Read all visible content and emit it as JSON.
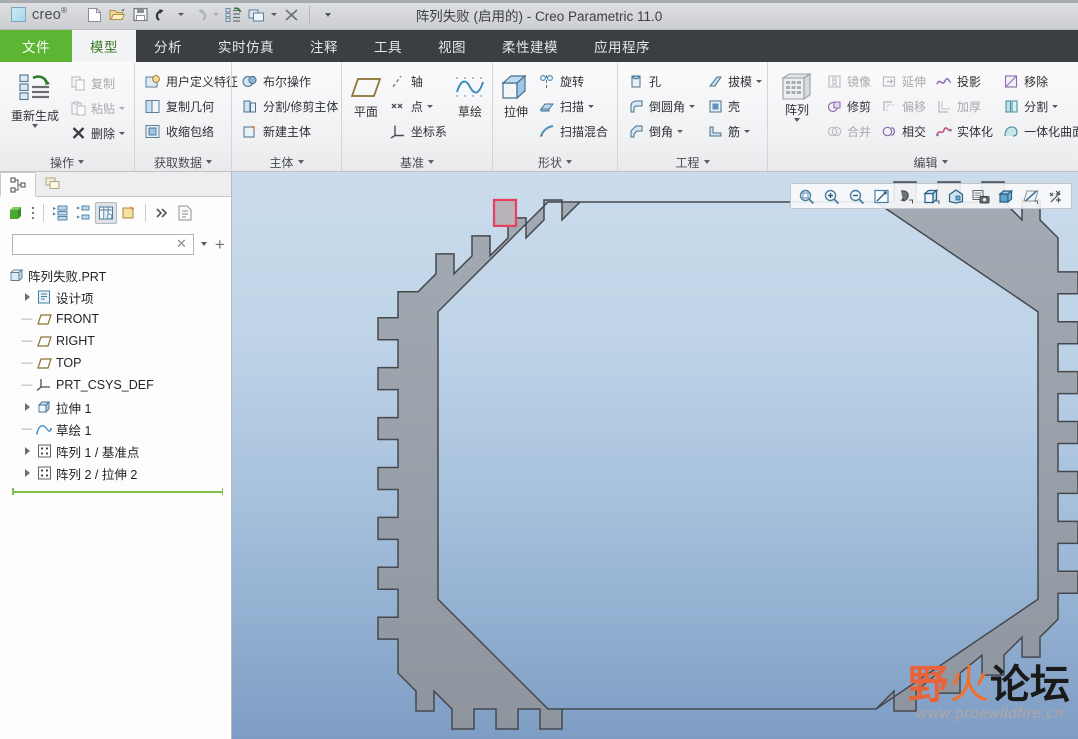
{
  "titlebar": {
    "brand": "creo",
    "brand_sup": "®",
    "document_title": "阵列失败 (启用的) - Creo Parametric 11.0",
    "quick_access": [
      {
        "name": "new-file-button",
        "icon": "new-file-icon",
        "label": "新建"
      },
      {
        "name": "open-file-button",
        "icon": "open-folder-icon",
        "label": "打开"
      },
      {
        "name": "save-button",
        "icon": "save-disk-icon",
        "label": "保存"
      },
      {
        "name": "undo-button",
        "icon": "undo-arrow-icon",
        "label": "撤消"
      },
      {
        "name": "redo-button",
        "icon": "redo-arrow-icon",
        "label": "重做"
      },
      {
        "name": "regenerate-button",
        "icon": "regenerate-icon",
        "label": "重新生成"
      },
      {
        "name": "window-button",
        "icon": "windows-icon",
        "label": "窗口"
      },
      {
        "name": "close-window-button",
        "icon": "close-x-icon",
        "label": "关闭"
      },
      {
        "name": "customize-qat-button",
        "icon": "chevron-down-icon",
        "label": "自定义快速访问工具栏"
      }
    ]
  },
  "ribbon_tabs": [
    {
      "label": "文件",
      "name": "tab-file",
      "kind": "file"
    },
    {
      "label": "模型",
      "name": "tab-model",
      "kind": "active"
    },
    {
      "label": "分析",
      "name": "tab-analysis",
      "kind": "normal"
    },
    {
      "label": "实时仿真",
      "name": "tab-live-sim",
      "kind": "normal"
    },
    {
      "label": "注释",
      "name": "tab-annotate",
      "kind": "normal"
    },
    {
      "label": "工具",
      "name": "tab-tools",
      "kind": "normal"
    },
    {
      "label": "视图",
      "name": "tab-view",
      "kind": "normal"
    },
    {
      "label": "柔性建模",
      "name": "tab-flexible-modeling",
      "kind": "normal"
    },
    {
      "label": "应用程序",
      "name": "tab-applications",
      "kind": "normal"
    }
  ],
  "ribbon_groups": [
    {
      "title": "操作",
      "name": "ribbon-group-operations",
      "big": {
        "label": "重新生成",
        "name": "regenerate-big-button",
        "icon": "regenerate-icon",
        "has_caret": true
      },
      "items": [
        {
          "label": "复制",
          "name": "copy-button",
          "icon": "copy-icon",
          "disabled": true,
          "caret": false
        },
        {
          "label": "粘贴",
          "name": "paste-button",
          "icon": "paste-icon",
          "disabled": true,
          "caret": true
        },
        {
          "label": "删除",
          "name": "delete-button",
          "icon": "delete-x-icon",
          "disabled": false,
          "caret": true
        }
      ]
    },
    {
      "title": "获取数据",
      "name": "ribbon-group-get-data",
      "items": [
        {
          "label": "用户定义特征",
          "name": "udf-button",
          "icon": "udf-icon",
          "disabled": false,
          "caret": false
        },
        {
          "label": "复制几何",
          "name": "copy-geometry-button",
          "icon": "copy-geometry-icon",
          "disabled": false,
          "caret": false
        },
        {
          "label": "收缩包络",
          "name": "shrinkwrap-button",
          "icon": "shrinkwrap-icon",
          "disabled": false,
          "caret": false
        }
      ]
    },
    {
      "title": "主体",
      "name": "ribbon-group-body",
      "items": [
        {
          "label": "布尔操作",
          "name": "boolean-operation-button",
          "icon": "boolean-icon",
          "disabled": false,
          "caret": false
        },
        {
          "label": "分割/修剪主体",
          "name": "split-trim-body-button",
          "icon": "split-body-icon",
          "disabled": false,
          "caret": false
        },
        {
          "label": "新建主体",
          "name": "new-body-button",
          "icon": "new-body-icon",
          "disabled": false,
          "caret": false
        }
      ]
    },
    {
      "title": "基准",
      "name": "ribbon-group-datum",
      "plane": {
        "label": "平面",
        "name": "datum-plane-button",
        "icon": "datum-plane-icon"
      },
      "sketch": {
        "label": "草绘",
        "name": "sketch-button",
        "icon": "sketch-icon"
      },
      "items": [
        {
          "label": "轴",
          "name": "datum-axis-button",
          "icon": "datum-axis-icon",
          "disabled": false,
          "caret": false
        },
        {
          "label": "点",
          "name": "datum-point-button",
          "icon": "datum-point-icon",
          "disabled": false,
          "caret": true
        },
        {
          "label": "坐标系",
          "name": "datum-csys-button",
          "icon": "datum-csys-icon",
          "disabled": false,
          "caret": false
        }
      ]
    },
    {
      "title": "形状",
      "name": "ribbon-group-shapes",
      "big": {
        "label": "拉伸",
        "name": "extrude-button",
        "icon": "extrude-icon",
        "has_caret": false
      },
      "items": [
        {
          "label": "旋转",
          "name": "revolve-button",
          "icon": "revolve-icon",
          "disabled": false,
          "caret": false
        },
        {
          "label": "扫描",
          "name": "sweep-button",
          "icon": "sweep-icon",
          "disabled": false,
          "caret": true
        },
        {
          "label": "扫描混合",
          "name": "swept-blend-button",
          "icon": "swept-blend-icon",
          "disabled": false,
          "caret": false
        }
      ]
    },
    {
      "title": "工程",
      "name": "ribbon-group-engineering",
      "col_a": [
        {
          "label": "孔",
          "name": "hole-button",
          "icon": "hole-icon",
          "disabled": false,
          "caret": false
        },
        {
          "label": "倒圆角",
          "name": "round-button",
          "icon": "round-icon",
          "disabled": false,
          "caret": true
        },
        {
          "label": "倒角",
          "name": "chamfer-button",
          "icon": "chamfer-icon",
          "disabled": false,
          "caret": true
        }
      ],
      "col_b": [
        {
          "label": "拔模",
          "name": "draft-button",
          "icon": "draft-icon",
          "disabled": false,
          "caret": true
        },
        {
          "label": "壳",
          "name": "shell-button",
          "icon": "shell-icon",
          "disabled": false,
          "caret": false
        },
        {
          "label": "筋",
          "name": "rib-button",
          "icon": "rib-icon",
          "disabled": false,
          "caret": true
        }
      ]
    },
    {
      "title": "编辑",
      "name": "ribbon-group-edit",
      "big": {
        "label": "阵列",
        "name": "pattern-button",
        "icon": "pattern-icon",
        "has_caret": true
      },
      "col_a": [
        {
          "label": "镜像",
          "name": "mirror-button",
          "icon": "mirror-icon",
          "disabled": true,
          "caret": false
        },
        {
          "label": "修剪",
          "name": "trim-button",
          "icon": "trim-icon",
          "disabled": false,
          "caret": false
        },
        {
          "label": "合并",
          "name": "merge-button",
          "icon": "merge-icon",
          "disabled": true,
          "caret": false
        }
      ],
      "col_b": [
        {
          "label": "延伸",
          "name": "extend-button",
          "icon": "extend-icon",
          "disabled": true,
          "caret": false
        },
        {
          "label": "偏移",
          "name": "offset-button",
          "icon": "offset-icon",
          "disabled": true,
          "caret": false
        },
        {
          "label": "相交",
          "name": "intersect-button",
          "icon": "intersect-icon",
          "disabled": false,
          "caret": false
        }
      ],
      "col_c": [
        {
          "label": "投影",
          "name": "project-button",
          "icon": "project-icon",
          "disabled": false,
          "caret": false
        },
        {
          "label": "加厚",
          "name": "thicken-button",
          "icon": "thicken-icon",
          "disabled": true,
          "caret": false
        },
        {
          "label": "实体化",
          "name": "solidify-button",
          "icon": "solidify-icon",
          "disabled": false,
          "caret": false
        }
      ],
      "col_d": [
        {
          "label": "移除",
          "name": "remove-button",
          "icon": "remove-icon",
          "disabled": false,
          "caret": false
        },
        {
          "label": "分割",
          "name": "split-surface-button",
          "icon": "split-icon",
          "disabled": false,
          "caret": true
        },
        {
          "label": "一体化曲面",
          "name": "unified-surface-button",
          "icon": "unified-surface-icon",
          "disabled": false,
          "caret": false
        }
      ]
    }
  ],
  "navigator": {
    "tabs": [
      {
        "name": "nav-tab-model-tree",
        "icon": "model-tree-icon",
        "active": true
      },
      {
        "name": "nav-tab-layers",
        "icon": "layers-icon",
        "active": false
      }
    ],
    "toolbar": [
      {
        "name": "show-button",
        "icon": "green-cube-icon",
        "active": false
      },
      {
        "name": "tree-options-button",
        "icon": "vertical-dots-icon",
        "active": false
      },
      {
        "name": "expand-tree-button",
        "icon": "expand-tree-icon",
        "active": false
      },
      {
        "name": "collapse-tree-button",
        "icon": "collapse-tree-icon",
        "active": false
      },
      {
        "name": "tree-columns-button",
        "icon": "tree-columns-icon",
        "active": true
      },
      {
        "name": "tree-filters-button",
        "icon": "tree-filter-icon",
        "active": false
      },
      {
        "name": "more-options-button",
        "icon": "double-chevron-icon",
        "active": false
      },
      {
        "name": "detail-pane-button",
        "icon": "detail-pane-icon",
        "active": false
      }
    ],
    "filter": {
      "name": "tree-search-input",
      "value": "",
      "placeholder": "",
      "icon": "funnel-icon",
      "clear_label": "✕",
      "add_label": "+"
    },
    "tree": [
      {
        "label": "阵列失败.PRT",
        "name": "tree-item-part-root",
        "icon": "part-icon",
        "indent": 0,
        "marker": "none"
      },
      {
        "label": "设计项",
        "name": "tree-item-design-items",
        "icon": "design-items-icon",
        "indent": 1,
        "marker": "expand"
      },
      {
        "label": "FRONT",
        "name": "tree-item-front-plane",
        "icon": "plane-icon",
        "indent": 1,
        "marker": "dash"
      },
      {
        "label": "RIGHT",
        "name": "tree-item-right-plane",
        "icon": "plane-icon",
        "indent": 1,
        "marker": "dash"
      },
      {
        "label": "TOP",
        "name": "tree-item-top-plane",
        "icon": "plane-icon",
        "indent": 1,
        "marker": "dash"
      },
      {
        "label": "PRT_CSYS_DEF",
        "name": "tree-item-csys",
        "icon": "csys-icon",
        "indent": 1,
        "marker": "dash"
      },
      {
        "label": "拉伸 1",
        "name": "tree-item-extrude-1",
        "icon": "extrude-feat-icon",
        "indent": 1,
        "marker": "expand"
      },
      {
        "label": "草绘 1",
        "name": "tree-item-sketch-1",
        "icon": "sketch-feat-icon",
        "indent": 1,
        "marker": "dash"
      },
      {
        "label": "阵列 1 / 基准点",
        "name": "tree-item-pattern-1",
        "icon": "pattern-feat-icon",
        "indent": 1,
        "marker": "expand"
      },
      {
        "label": "阵列 2 / 拉伸 2",
        "name": "tree-item-pattern-2",
        "icon": "pattern-feat-icon",
        "indent": 1,
        "marker": "expand"
      }
    ],
    "insert_indicator": {
      "name": "insert-here-indicator",
      "color": "#7fc14a"
    }
  },
  "graphics_toolbar": [
    {
      "name": "zoom-to-fit-button",
      "icon": "magnifier-box-icon"
    },
    {
      "name": "zoom-in-button",
      "icon": "magnifier-plus-icon"
    },
    {
      "name": "zoom-out-button",
      "icon": "magnifier-minus-icon"
    },
    {
      "name": "refit-button",
      "icon": "refit-diagonal-icon"
    },
    {
      "name": "spin-center-button",
      "icon": "spin-center-icon"
    },
    {
      "name": "display-style-button",
      "icon": "cube-shaded-icon"
    },
    {
      "name": "appearance-gallery-button",
      "icon": "appearance-icon"
    },
    {
      "name": "saved-views-button",
      "icon": "saved-views-camera-icon"
    },
    {
      "name": "view-manager-button",
      "icon": "view-manager-cube-icon"
    },
    {
      "name": "datum-display-button",
      "icon": "datum-display-icon"
    },
    {
      "name": "annotation-display-button",
      "icon": "annotation-display-icon"
    }
  ],
  "viewport": {
    "name": "graphics-viewport",
    "background_top": "#cbdcec",
    "background_bottom": "#7e9dc4",
    "model": {
      "name": "octagonal-gear-ring-model",
      "face_color": "#9aa1aa",
      "edge_color": "#44484d",
      "highlight_color": "#e8415f",
      "highlighted_feature_label": "阵列 2 / 拉伸 2",
      "description": "八边形齿环 (octagonal toothed ring)"
    },
    "watermark": {
      "name": "forum-watermark",
      "text_left": "野",
      "flame": "火",
      "text_right": "论坛",
      "url": "www.proewildfire.cn",
      "color_left": "#e8623a",
      "color_flame": "#f2702e",
      "color_right": "#1a1a1a"
    }
  }
}
